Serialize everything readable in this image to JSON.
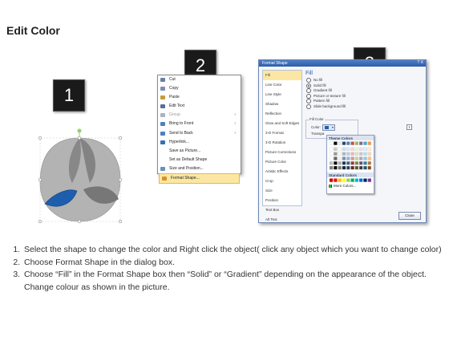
{
  "page": {
    "title": "Edit Color"
  },
  "badges": {
    "b1": "1",
    "b2": "2",
    "b3": "3"
  },
  "context_menu": {
    "items": [
      {
        "label": "Cut",
        "icon": "scissors-icon",
        "enabled": true,
        "submenu": false
      },
      {
        "label": "Copy",
        "icon": "copy-icon",
        "enabled": true,
        "submenu": false
      },
      {
        "label": "Paste",
        "icon": "paste-icon",
        "enabled": true,
        "submenu": false
      },
      {
        "label": "Edit Text",
        "icon": "edit-text-icon",
        "enabled": true,
        "submenu": false
      },
      {
        "label": "Group",
        "icon": "group-icon",
        "enabled": false,
        "submenu": true
      },
      {
        "label": "Bring to Front",
        "icon": "bring-front-icon",
        "enabled": true,
        "submenu": true
      },
      {
        "label": "Send to Back",
        "icon": "send-back-icon",
        "enabled": true,
        "submenu": true
      },
      {
        "label": "Hyperlink...",
        "icon": "hyperlink-icon",
        "enabled": true,
        "submenu": false
      },
      {
        "label": "Save as Picture...",
        "icon": "",
        "enabled": true,
        "submenu": false
      },
      {
        "label": "Set as Default Shape",
        "icon": "",
        "enabled": true,
        "submenu": false
      },
      {
        "label": "Size and Position...",
        "icon": "size-icon",
        "enabled": true,
        "submenu": false
      },
      {
        "label": "Format Shape...",
        "icon": "format-shape-icon",
        "enabled": true,
        "submenu": false,
        "highlighted": true
      }
    ]
  },
  "dialog": {
    "title": "Format Shape",
    "controls": "? X",
    "nav": [
      "Fill",
      "Line Color",
      "Line Style",
      "Shadow",
      "Reflection",
      "Glow and Soft Edges",
      "3-D Format",
      "3-D Rotation",
      "Picture Corrections",
      "Picture Color",
      "Artistic Effects",
      "Crop",
      "Size",
      "Position",
      "Text Box",
      "Alt Text"
    ],
    "selected_nav": "Fill",
    "panel_heading": "Fill",
    "options": [
      {
        "label": "No fill",
        "selected": false
      },
      {
        "label": "Solid fill",
        "selected": true
      },
      {
        "label": "Gradient fill",
        "selected": false
      },
      {
        "label": "Picture or texture fill",
        "selected": false
      },
      {
        "label": "Pattern fill",
        "selected": false
      },
      {
        "label": "Slide background fill",
        "selected": false
      }
    ],
    "fill_color_group": "Fill Color",
    "color_label": "Color:",
    "transparency_label": "Transpa",
    "palette": {
      "theme_header": "Theme Colors",
      "standard_header": "Standard Colors",
      "more_colors": "More Colors...",
      "theme_top": [
        "#ffffff",
        "#000000",
        "#eeece1",
        "#1f497d",
        "#4f81bd",
        "#c0504d",
        "#9bbb59",
        "#8064a2",
        "#4bacc6",
        "#f79646"
      ],
      "standard": [
        "#c00000",
        "#ff0000",
        "#ffc000",
        "#ffff00",
        "#92d050",
        "#00b050",
        "#00b0f0",
        "#0070c0",
        "#002060",
        "#7030a0"
      ]
    },
    "close_label": "Close"
  },
  "instructions": [
    "Select the shape to change the color and Right click the object( click any object which you want to change color)",
    "Choose Format Shape in the dialog box.",
    "Choose “Fill” in the Format Shape box then “Solid” or “Gradient” depending on the appearance of the object. Change colour as shown in the picture."
  ]
}
